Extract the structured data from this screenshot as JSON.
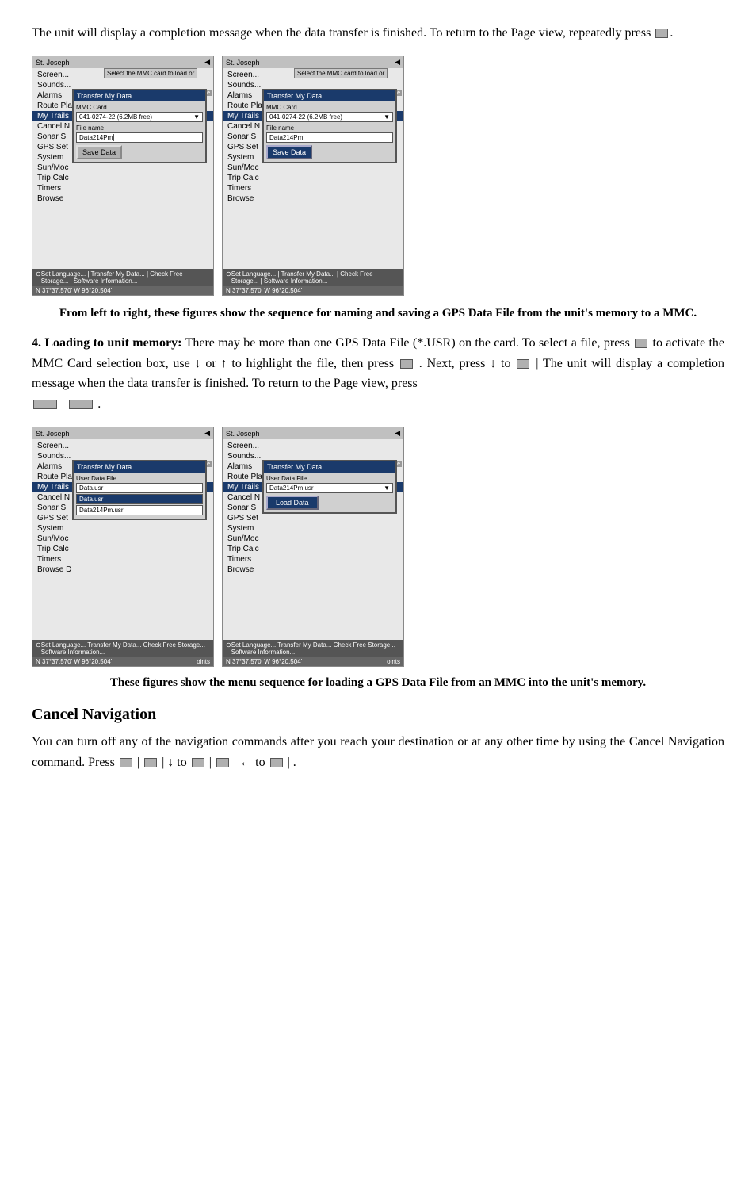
{
  "intro": {
    "text": "The unit will display a completion message when the data transfer is finished. To return to the Page view, repeatedly press"
  },
  "figure1_caption": "From left to right, these figures show the sequence for naming and saving a GPS Data File from the unit's memory to a MMC.",
  "section4": {
    "heading": "4. Loading to unit memory:",
    "body1": "There may be more than one GPS Data File (*.USR) on the card. To select a file, press",
    "body2": "to activate the MMC Card selection box, use ↓ or ↑ to highlight the file, then press",
    "body3": ". Next, press ↓ to",
    "body4": "The unit will display a completion message when the data transfer is finished. To return to the Page view, press",
    "pipe1": "|",
    "pipe2": "|",
    "period": "."
  },
  "figure2_caption": "These figures show the menu sequence for loading a GPS Data File from an MMC into the unit's memory.",
  "cancel_nav": {
    "heading": "Cancel Navigation",
    "body": "You can turn off any of the navigation commands after you reach your destination or at any other time by using the Cancel Navigation command. Press",
    "pipe1": "|",
    "arrow_down_to": "| ↓ to",
    "pipe2": "|",
    "arrow_left_to": "| ← to",
    "pipe3": "|",
    "period": "."
  },
  "screens": {
    "left1": {
      "menu_items": [
        "Screen...",
        "Sounds...",
        "Alarms",
        "Route Planning",
        "My Trails",
        "Cancel N",
        "Sonar S",
        "GPS Set",
        "System",
        "Sun/Moc",
        "Trip Calc",
        "Timers",
        "Browse"
      ],
      "highlight": "My Trails",
      "dialog_title": "Transfer My Data",
      "dialog_label1": "MMC Card",
      "dialog_select": "041-0274-22 (6.2MB free)",
      "dialog_label2": "File name",
      "dialog_input": "Data214Pm",
      "dialog_btn": "Save Data",
      "topbar_left": "St. Joseph",
      "topbar_right": "Select the MMC card to load or",
      "footer_coords": "37°37.570'",
      "footer_dir": "W 96°20.504'",
      "footer_right": "Software Information...",
      "extra_menu": [
        "Set Language...",
        "Transfer My Data...",
        "Check Free Storage...",
        "Software Information..."
      ]
    },
    "right1": {
      "menu_items": [
        "Screen...",
        "Sounds...",
        "Alarms",
        "Route Planning",
        "My Trails",
        "Cancel N",
        "Sonar S",
        "GPS Set",
        "System",
        "Sun/Moc",
        "Trip Calc",
        "Timers",
        "Browse"
      ],
      "highlight": "My Trails",
      "dialog_title": "Transfer My Data",
      "dialog_label1": "MMC Card",
      "dialog_select": "041-0274-22 (6.2MB free)",
      "dialog_label2": "File name",
      "dialog_input": "Data214Pm",
      "dialog_btn": "Save Data",
      "topbar_left": "St. Joseph",
      "topbar_right": "Select the MMC card to load or",
      "footer_coords": "37°37.570'",
      "footer_dir": "W 96°20.504'",
      "extra_menu": [
        "Set Language...",
        "Transfer My Data...",
        "Check Free Storage...",
        "Software Information..."
      ]
    },
    "left2": {
      "dialog_title": "Transfer My Data",
      "dialog_label1": "User Data File",
      "dialog_items": [
        "Data.usr",
        "Data.usr"
      ],
      "dialog_input": "Data214Pm.usr",
      "topbar_left": "St. Joseph",
      "footer_coords": "37°37.570'",
      "footer_dir": "W 96°20.504'",
      "extra_menu": [
        "Set Language...",
        "Transfer My Data...",
        "Check Free Storage...",
        "Software Information..."
      ]
    },
    "right2": {
      "dialog_title": "Transfer My Data",
      "dialog_label1": "User Data File",
      "dialog_select": "Data214Pm.usr",
      "dialog_btn": "Load Data",
      "topbar_left": "St. Joseph",
      "footer_coords": "37°37.570'",
      "footer_dir": "W 96°20.504'",
      "extra_menu": [
        "Set Language...",
        "Transfer My Data...",
        "Check Free Storage...",
        "Software Information..."
      ]
    }
  }
}
